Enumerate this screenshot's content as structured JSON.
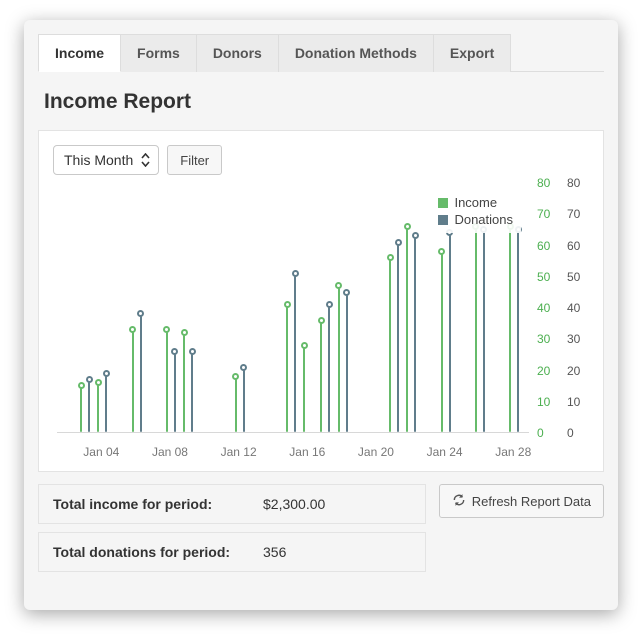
{
  "tabs": [
    "Income",
    "Forms",
    "Donors",
    "Donation Methods",
    "Export"
  ],
  "active_tab": 0,
  "report_title": "Income Report",
  "controls": {
    "range_value": "This Month",
    "filter_label": "Filter"
  },
  "legend": [
    "Income",
    "Donations"
  ],
  "colors": {
    "income": "#66bb6a",
    "donations": "#607d8b"
  },
  "totals": {
    "income_label": "Total income for period:",
    "income_value": "$2,300.00",
    "donations_label": "Total donations for period:",
    "donations_value": "356"
  },
  "refresh_label": "Refresh Report Data",
  "chart_data": {
    "type": "bar",
    "title": "Income Report",
    "xlabel": "",
    "ylabel_left": "Income",
    "ylabel_right": "Donations",
    "ylim": [
      0,
      80
    ],
    "yticks": [
      0,
      10,
      20,
      30,
      40,
      50,
      60,
      70,
      80
    ],
    "x_tick_labels": [
      "Jan 04",
      "Jan 08",
      "Jan 12",
      "Jan 16",
      "Jan 20",
      "Jan 24",
      "Jan 28"
    ],
    "x_tick_positions": [
      4,
      8,
      12,
      16,
      20,
      24,
      28
    ],
    "categories": [
      2,
      3,
      4,
      5,
      6,
      7,
      8,
      9,
      10,
      11,
      12,
      13,
      14,
      15,
      16,
      17,
      18,
      19,
      20,
      21,
      22,
      23,
      24,
      25,
      26,
      27,
      28
    ],
    "series": [
      {
        "name": "Income",
        "color": "#66bb6a",
        "values": [
          null,
          14,
          15,
          null,
          32,
          null,
          32,
          31,
          null,
          null,
          17,
          null,
          null,
          40,
          27,
          35,
          46,
          null,
          null,
          55,
          65,
          null,
          57,
          null,
          65,
          null,
          65
        ]
      },
      {
        "name": "Donations",
        "color": "#607d8b",
        "values": [
          null,
          16,
          18,
          null,
          37,
          null,
          25,
          25,
          null,
          null,
          20,
          null,
          null,
          50,
          null,
          40,
          44,
          null,
          null,
          60,
          62,
          null,
          63,
          null,
          64,
          null,
          64
        ]
      }
    ]
  }
}
